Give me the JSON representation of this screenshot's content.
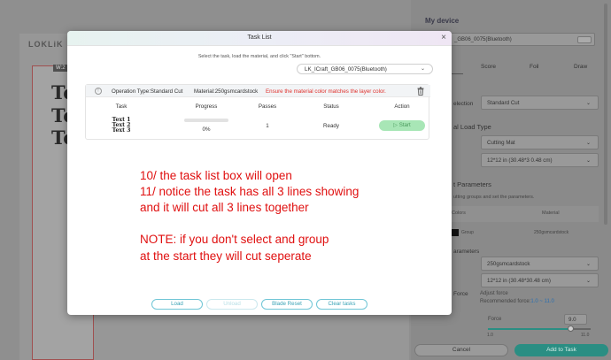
{
  "app": {
    "logo": "LOKLiK",
    "canvas_width_label": "W:2",
    "canvas_text_lines": [
      "Te",
      "Te",
      "Te"
    ]
  },
  "right_panel": {
    "device_title": "My device",
    "device_select": "_GB06_0075(Bluetooth)",
    "tabs": [
      "Score",
      "Foil",
      "Draw"
    ],
    "selection_label": "election",
    "selection_value": "Standard Cut",
    "load_type_label": "al Load Type",
    "load_type_value": "Cutting Mat",
    "mat_size_value": "12*12 in (30.48*3 0.48 cm)",
    "parameters_label": "t Parameters",
    "parameters_hint": "utting groups and set the parameters.",
    "colors_header": "Colors",
    "material_header": "Material",
    "group_label": "Group",
    "group_material": "250gsmcardstock",
    "params_label": "arameters",
    "params_material": "250gsmcardstock",
    "params_size": "12*12 in (30.48*30.48 cm)",
    "force_label": "Force",
    "adjust_force": "Adjust force",
    "recommended_prefix": "Recommended force:",
    "recommended_range": "1.0 ~ 11.0",
    "force_slider_label": "Force",
    "force_value": "9.0",
    "slider_min": "1.0",
    "slider_max": "11.0",
    "force_level": 0.8,
    "cancel_label": "Cancel",
    "add_label": "Add to Task"
  },
  "modal": {
    "title": "Task List",
    "description": "Select the task, load the material, and click \"Start\" bottom.",
    "device_select": "LK_ICraft_GB06_0075(Bluetooth)",
    "operation_type": "Operation Type:Standard Cut",
    "material": "Material:250gsmcardstock",
    "warning": "Ensure the material color matches the layer color.",
    "columns": {
      "task": "Task",
      "progress": "Progress",
      "passes": "Passes",
      "status": "Status",
      "action": "Action"
    },
    "task": {
      "names": [
        "Text 1",
        "Text 2",
        "Text 3"
      ],
      "progress": "0%",
      "passes": "1",
      "status": "Ready",
      "action": "Start"
    },
    "footer_buttons": {
      "load": "Load",
      "unload": "Unload",
      "blade_reset": "Blade Reset",
      "clear_tasks": "Clear tasks"
    }
  },
  "annotation": {
    "lines": [
      "10/ the task list box will open",
      "11/ notice the task has all 3 lines showing",
      "and it will cut all 3 lines together",
      "",
      "NOTE: if you don't select and group",
      "at the start they will cut seperate"
    ]
  },
  "colors": {
    "accent_teal": "#2a8e83",
    "warning_red": "#e0322d",
    "annotation_red": "#e01010",
    "start_green": "#a8e6b6"
  }
}
